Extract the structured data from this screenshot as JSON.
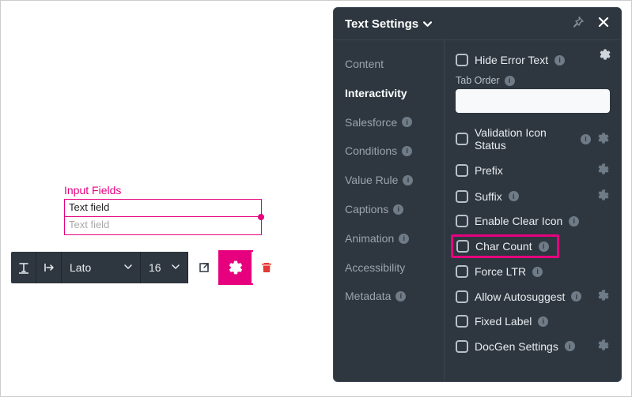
{
  "canvas": {
    "group_label": "Input Fields",
    "field1_value": "Text field",
    "field2_placeholder": "Text field"
  },
  "toolbar": {
    "font_family": "Lato",
    "font_size": "16"
  },
  "panel": {
    "title": "Text Settings",
    "sidebar": [
      {
        "label": "Content",
        "active": false,
        "info": false
      },
      {
        "label": "Interactivity",
        "active": true,
        "info": false
      },
      {
        "label": "Salesforce",
        "active": false,
        "info": true
      },
      {
        "label": "Conditions",
        "active": false,
        "info": true
      },
      {
        "label": "Value Rule",
        "active": false,
        "info": true
      },
      {
        "label": "Captions",
        "active": false,
        "info": true
      },
      {
        "label": "Animation",
        "active": false,
        "info": true
      },
      {
        "label": "Accessibility",
        "active": false,
        "info": false
      },
      {
        "label": "Metadata",
        "active": false,
        "info": true
      }
    ],
    "tab_order_label": "Tab Order",
    "tab_order_value": "",
    "options": {
      "hide_error_text": "Hide Error Text",
      "validation_icon_status": "Validation Icon Status",
      "prefix": "Prefix",
      "suffix": "Suffix",
      "enable_clear_icon": "Enable Clear Icon",
      "char_count": "Char Count",
      "force_ltr": "Force LTR",
      "allow_autosuggest": "Allow Autosuggest",
      "fixed_label": "Fixed Label",
      "docgen_settings": "DocGen Settings"
    }
  }
}
